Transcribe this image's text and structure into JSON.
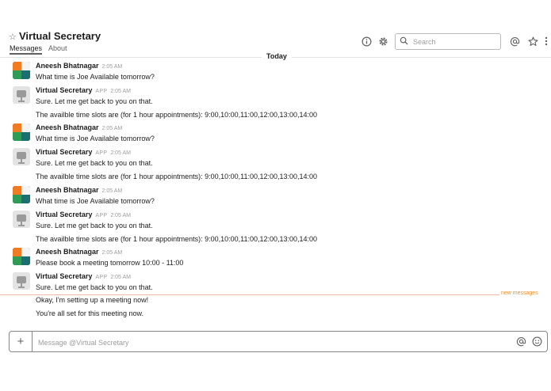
{
  "channel": {
    "title": "Virtual Secretary",
    "tabs": [
      {
        "label": "Messages"
      },
      {
        "label": "About"
      }
    ]
  },
  "header_icons": [
    "star-icon",
    "info-icon",
    "gear-icon",
    "search-icon",
    "mention-icon",
    "saved-star-icon",
    "more-vertical-icon"
  ],
  "search": {
    "placeholder": "Search",
    "value": ""
  },
  "date_divider": "Today",
  "new_messages_label": "new messages",
  "messages": [
    {
      "author": "Aneesh Bhatnagar",
      "app": "",
      "time": "2:05 AM",
      "lines": [
        "What time is Joe Available tomorrow?"
      ]
    },
    {
      "author": "Virtual Secretary",
      "app": "APP",
      "time": "2:05 AM",
      "lines": [
        "Sure. Let me get back to you on that.",
        "The availble time slots are (for 1 hour appointments): 9:00,10:00,11:00,12:00,13:00,14:00"
      ]
    },
    {
      "author": "Aneesh Bhatnagar",
      "app": "",
      "time": "2:05 AM",
      "lines": [
        "What time is Joe Available tomorrow?"
      ]
    },
    {
      "author": "Virtual Secretary",
      "app": "APP",
      "time": "2:05 AM",
      "lines": [
        "Sure. Let me get back to you on that.",
        "The availble time slots are (for 1 hour appointments): 9:00,10:00,11:00,12:00,13:00,14:00"
      ]
    },
    {
      "author": "Aneesh Bhatnagar",
      "app": "",
      "time": "2:05 AM",
      "lines": [
        "What time is Joe Available tomorrow?"
      ]
    },
    {
      "author": "Virtual Secretary",
      "app": "APP",
      "time": "2:05 AM",
      "lines": [
        "Sure. Let me get back to you on that.",
        "The availble time slots are (for 1 hour appointments): 9:00,10:00,11:00,12:00,13:00,14:00"
      ]
    },
    {
      "author": "Aneesh Bhatnagar",
      "app": "",
      "time": "2:05 AM",
      "lines": [
        "Please book a meeting tomorrow 10:00 - 11:00"
      ]
    },
    {
      "author": "Virtual Secretary",
      "app": "APP",
      "time": "2:05 AM",
      "lines": [
        "Sure. Let me get back to you on that.",
        "Okay, I'm setting up a meeting now!",
        "You're all set for this meeting now."
      ]
    }
  ],
  "composer": {
    "placeholder": "Message @Virtual Secretary",
    "value": ""
  },
  "colors": {
    "avatar_orange": "#f07b23",
    "avatar_green": "#2f9b57",
    "avatar_teal": "#1b6e72",
    "avatar_white": "#f4f4f4",
    "new_messages_line": "#f3b6a8",
    "new_messages_text": "#e8912d"
  }
}
